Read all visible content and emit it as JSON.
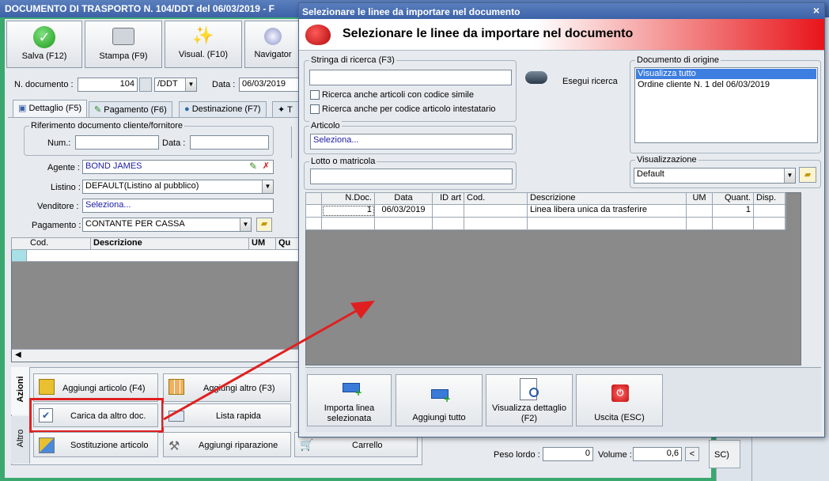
{
  "main": {
    "title": "DOCUMENTO DI TRASPORTO N. 104/DDT del 06/03/2019 - F",
    "toolbar": {
      "save": "Salva (F12)",
      "print": "Stampa (F9)",
      "visual": "Visual. (F10)",
      "navigator": "Navigator"
    },
    "ndoc_label": "N. documento :",
    "ndoc_value": "104",
    "ndoc_suffix": "/DDT",
    "data_label": "Data :",
    "data_value": "06/03/2019",
    "tabs": [
      "Dettaglio (F5)",
      "Pagamento (F6)",
      "Destinazione (F7)",
      "T"
    ],
    "rif_title": "Riferimento documento cliente/fornitore",
    "num_label": "Num.:",
    "rif_data_label": "Data :",
    "agente_label": "Agente :",
    "agente_value": "BOND JAMES",
    "listino_label": "Listino :",
    "listino_value": "DEFAULT(Listino al pubblico)",
    "venditore_label": "Venditore :",
    "venditore_value": "Seleziona...",
    "pagamento_label": "Pagamento :",
    "pagamento_value": "CONTANTE PER CASSA",
    "grid_cols": [
      "Cod.",
      "Descrizione",
      "UM",
      "Qu"
    ],
    "side_tabs": [
      "Azioni",
      "Altro"
    ],
    "actions": {
      "aggiungi_articolo": "Aggiungi articolo (F4)",
      "aggiungi_altro": "Aggiungi altro (F3)",
      "carica": "Carica da altro doc.",
      "lista_rapida": "Lista rapida",
      "sostituzione": "Sostituzione articolo",
      "riparazione": "Aggiungi riparazione",
      "carrello": "Carrello"
    },
    "peso_label": "Peso lordo :",
    "peso_value": "0",
    "volume_label": "Volume :",
    "volume_value": "0,6",
    "volume_btn": "<",
    "right_fragment": "SC)"
  },
  "dialog": {
    "title": "Selezionare le linee da importare nel documento",
    "close": "×",
    "header": "Selezionare le linee da importare nel documento",
    "search_label": "Stringa di ricerca (F3)",
    "search_value": "",
    "cb1": "Ricerca anche articoli con codice simile",
    "cb2": "Ricerca anche per codice articolo intestatario",
    "search_btn": "Esegui ricerca",
    "articolo_label": "Articolo",
    "articolo_value": "Seleziona...",
    "lotto_label": "Lotto o matricola",
    "lotto_value": "",
    "origine_label": "Documento di origine",
    "origine_items": [
      "Visualizza tutto",
      "Ordine cliente N. 1 del 06/03/2019"
    ],
    "visual_label": "Visualizzazione",
    "visual_value": "Default",
    "cols": [
      "N.Doc.",
      "Data",
      "ID art",
      "Cod.",
      "Descrizione",
      "UM",
      "Quant.",
      "Disp."
    ],
    "row": {
      "ndoc": "1",
      "data": "06/03/2019",
      "idart": "",
      "cod": "",
      "descr": "Linea libera unica da trasferire",
      "um": "",
      "quant": "1",
      "disp": ""
    },
    "buttons": {
      "importa": "Importa linea selezionata",
      "aggiungi_tutto": "Aggiungi tutto",
      "dettaglio": "Visualizza dettaglio (F2)",
      "uscita": "Uscita (ESC)"
    }
  },
  "colors": {
    "accent_green": "#1a9a1a",
    "title_blue": "#3c62a8",
    "dialog_red": "#e8141a",
    "highlight": "#e02020"
  }
}
